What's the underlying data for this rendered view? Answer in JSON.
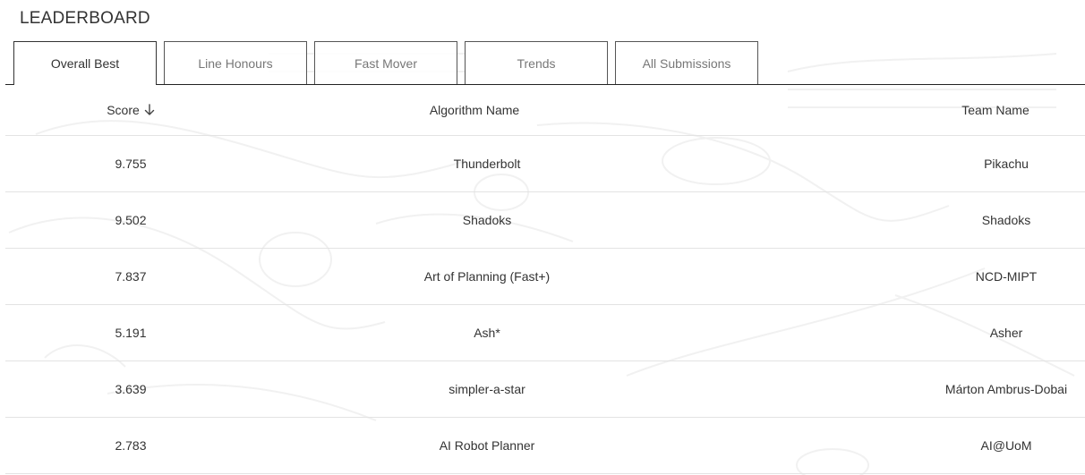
{
  "header": {
    "title": "LEADERBOARD"
  },
  "tabs": [
    {
      "label": "Overall Best",
      "active": true
    },
    {
      "label": "Line Honours",
      "active": false
    },
    {
      "label": "Fast Mover",
      "active": false
    },
    {
      "label": "Trends",
      "active": false
    },
    {
      "label": "All Submissions",
      "active": false
    }
  ],
  "table": {
    "columns": {
      "score": "Score",
      "algorithm": "Algorithm Name",
      "team": "Team Name"
    },
    "sort": {
      "column": "score",
      "direction": "descending",
      "icon": "arrow-down-icon"
    },
    "rows": [
      {
        "score": "9.755",
        "algorithm": "Thunderbolt",
        "team": "Pikachu"
      },
      {
        "score": "9.502",
        "algorithm": "Shadoks",
        "team": "Shadoks"
      },
      {
        "score": "7.837",
        "algorithm": "Art of Planning (Fast+)",
        "team": "NCD-MIPT"
      },
      {
        "score": "5.191",
        "algorithm": "Ash*",
        "team": "Asher"
      },
      {
        "score": "3.639",
        "algorithm": "simpler-a-star",
        "team": "Márton Ambrus-Dobai"
      },
      {
        "score": "2.783",
        "algorithm": "AI Robot Planner",
        "team": "AI@UoM"
      }
    ]
  }
}
